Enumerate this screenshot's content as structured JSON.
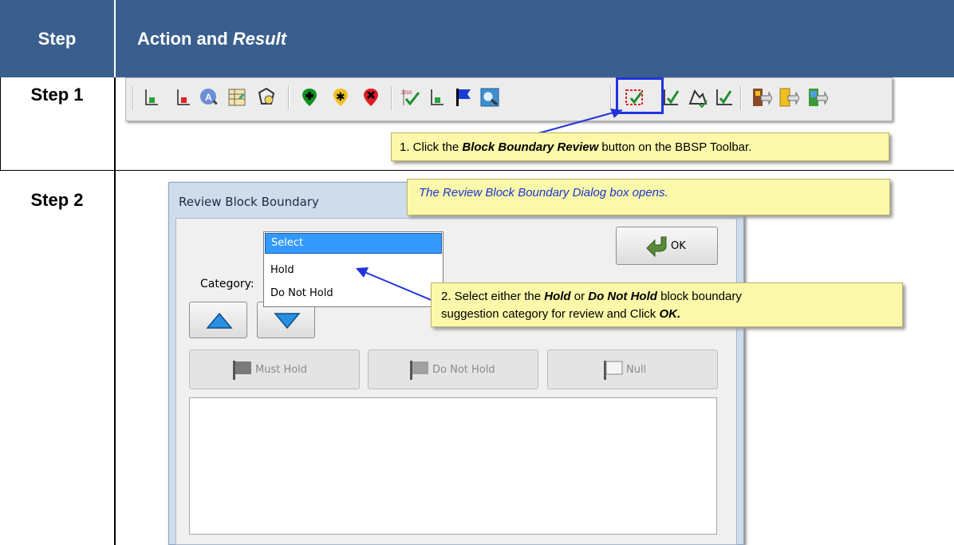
{
  "header": {
    "step_label": "Step",
    "action_label": "Action and ",
    "result_label": "Result"
  },
  "rows": [
    {
      "step": "Step 1"
    },
    {
      "step": "Step 2"
    }
  ],
  "toolbar": {
    "icons": [
      "block-add-icon",
      "block-delete-icon",
      "search-address-icon",
      "table-edit-icon",
      "polygon-edit-icon",
      "add-point-icon",
      "move-point-icon",
      "delete-point-icon",
      "2010-check-icon",
      "block-flag-icon",
      "blue-flag-icon",
      "zoom-map-icon",
      "block-boundary-review-icon",
      "boundary-check-icon",
      "shape-edit-icon",
      "polygon-check-icon",
      "export-icon",
      "export-yellow-icon",
      "export-blue-icon"
    ]
  },
  "callouts": {
    "step1": {
      "pre": "1. Click the ",
      "bold": "Block Boundary Review",
      "post": " button on the BBSP Toolbar."
    },
    "step2_open": "The Review Block Boundary Dialog box opens.",
    "step2_select": {
      "pre": "2. Select either the ",
      "hold": "Hold",
      "mid": " or ",
      "donothold": "Do Not Hold",
      "post1": " block boundary",
      "line2": "suggestion category for review and Click ",
      "ok": "OK."
    }
  },
  "dialog": {
    "title": "Review Block Boundary",
    "category_label": "Category:",
    "dropdown": {
      "selected": "Select",
      "options": [
        "Hold",
        "Do Not Hold"
      ]
    },
    "ok_button": "OK",
    "must_hold_button": "Must Hold",
    "do_not_hold_button": "Do Not Hold",
    "null_button": "Null"
  },
  "colors": {
    "header_bg": "#3a5f8f",
    "callout_bg": "#fbf8a9",
    "highlight_border": "#2233dd",
    "selected_item": "#3399ff"
  }
}
